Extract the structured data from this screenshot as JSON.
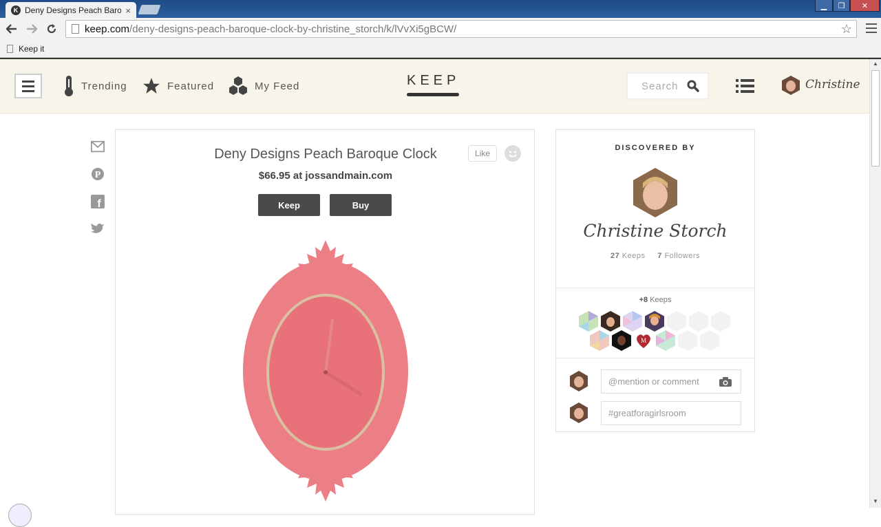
{
  "browser": {
    "tab_title": "Deny Designs Peach Baroque Clock by Christine Storch - Keep",
    "tab_close": "×",
    "url_host": "keep.com",
    "url_path": "/deny-designs-peach-baroque-clock-by-christine_storch/k/lVvXi5gBCW/",
    "bookmark_label": "Keep it"
  },
  "header": {
    "nav": [
      {
        "label": "Trending",
        "icon": "thermometer-icon"
      },
      {
        "label": "Featured",
        "icon": "star-icon"
      },
      {
        "label": "My Feed",
        "icon": "hexagons-icon"
      }
    ],
    "logo": "KEEP",
    "search_placeholder": "Search",
    "user_name": "Christine"
  },
  "product": {
    "title": "Deny Designs Peach Baroque Clock",
    "price": "$66.95 at jossandmain.com",
    "keep_label": "Keep",
    "buy_label": "Buy",
    "like_label": "Like",
    "image_color": "#ec7f86"
  },
  "discovered": {
    "label": "DISCOVERED BY",
    "name": "Christine Storch",
    "keeps_count": "27",
    "keeps_label": "Keeps",
    "followers_count": "7",
    "followers_label": "Followers",
    "more_keeps_count": "+8",
    "more_keeps_label": "Keeps"
  },
  "comments": {
    "mention_placeholder": "@mention or comment",
    "hashtag_value": "#greatforagirlsroom"
  },
  "colors": {
    "header_bg": "#f7f4e9",
    "button_bg": "#4a4a4a",
    "clock_pink": "#ec7f86"
  }
}
